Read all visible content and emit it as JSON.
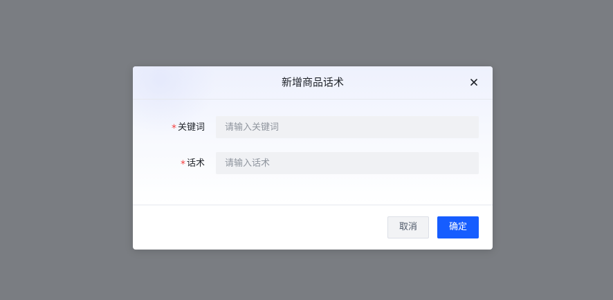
{
  "dialog": {
    "title": "新增商品话术",
    "close_icon": "close-icon"
  },
  "form": {
    "keyword": {
      "required_mark": "*",
      "label": "关键词",
      "placeholder": "请输入关键词",
      "value": ""
    },
    "script": {
      "required_mark": "*",
      "label": "话术",
      "placeholder": "请输入话术",
      "value": ""
    }
  },
  "footer": {
    "cancel_label": "取消",
    "confirm_label": "确定"
  },
  "colors": {
    "overlay": "#7a7d82",
    "primary": "#165dff",
    "required": "#f53f3f",
    "input_bg": "#f0f1f4"
  }
}
